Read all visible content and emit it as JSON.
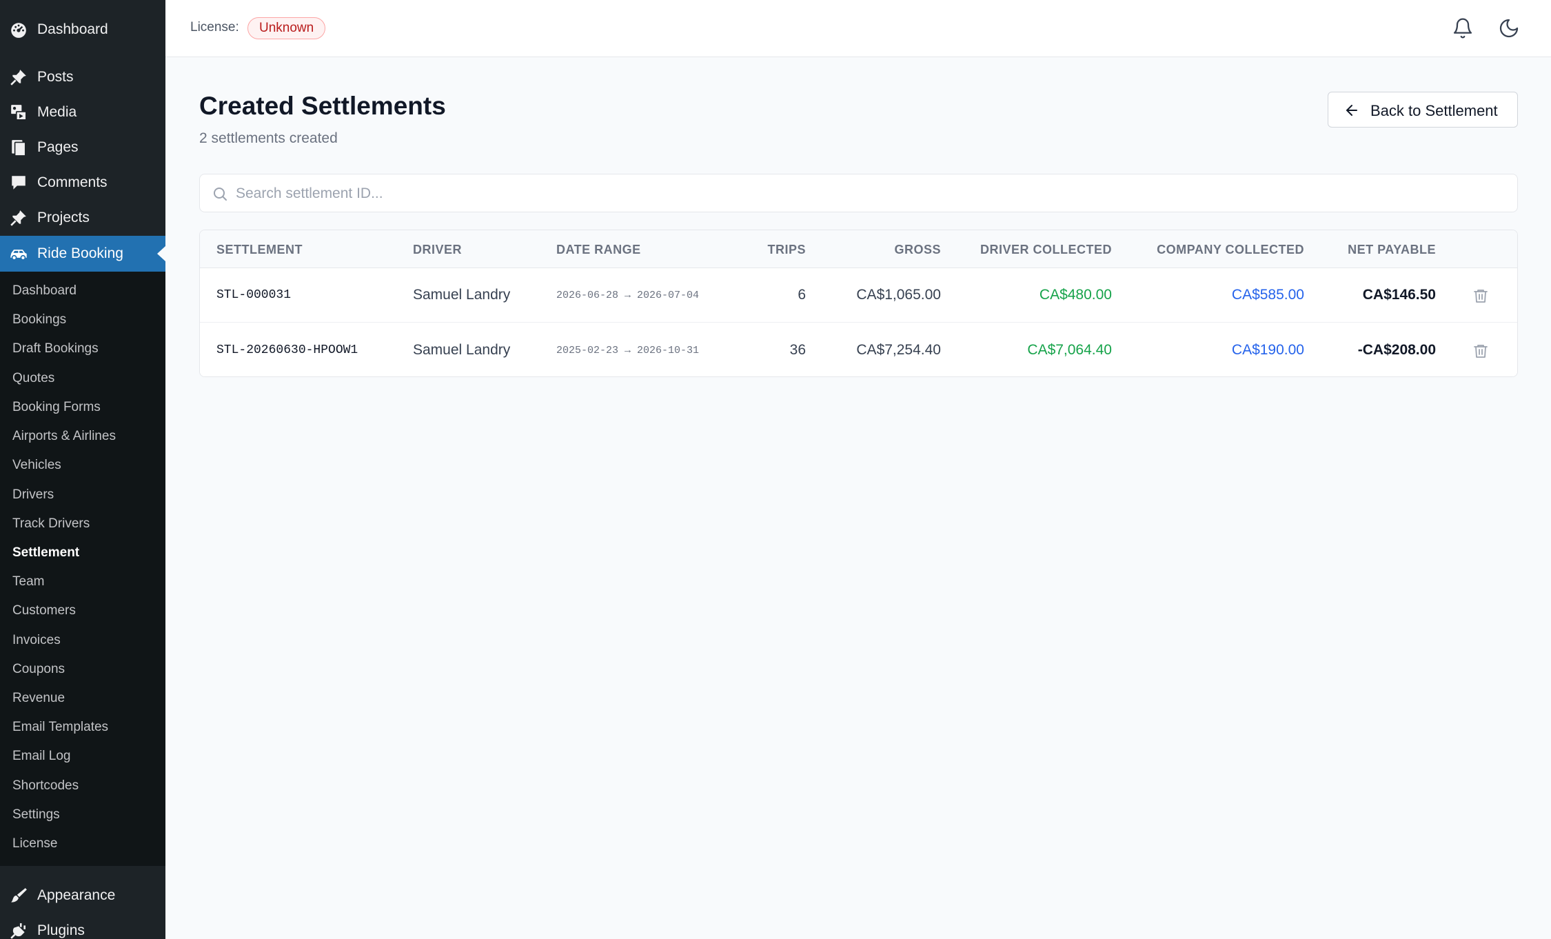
{
  "sidebar": {
    "top_items": [
      {
        "label": "Dashboard",
        "icon": "dashboard-icon"
      },
      {
        "label": "Posts",
        "icon": "pin-icon"
      },
      {
        "label": "Media",
        "icon": "media-icon"
      },
      {
        "label": "Pages",
        "icon": "pages-icon"
      },
      {
        "label": "Comments",
        "icon": "comment-icon"
      },
      {
        "label": "Projects",
        "icon": "pin-icon"
      },
      {
        "label": "Ride Booking",
        "icon": "car-icon"
      }
    ],
    "submenu": [
      "Dashboard",
      "Bookings",
      "Draft Bookings",
      "Quotes",
      "Booking Forms",
      "Airports & Airlines",
      "Vehicles",
      "Drivers",
      "Track Drivers",
      "Settlement",
      "Team",
      "Customers",
      "Invoices",
      "Coupons",
      "Revenue",
      "Email Templates",
      "Email Log",
      "Shortcodes",
      "Settings",
      "License"
    ],
    "current_submenu": "Settlement",
    "bottom_items": [
      {
        "label": "Appearance",
        "icon": "brush-icon"
      },
      {
        "label": "Plugins",
        "icon": "plugin-icon"
      }
    ]
  },
  "topbar": {
    "license_label": "License:",
    "license_status": "Unknown"
  },
  "header": {
    "title": "Created Settlements",
    "subtitle": "2 settlements created",
    "back_button": "Back to Settlement"
  },
  "search": {
    "placeholder": "Search settlement ID..."
  },
  "table": {
    "columns": [
      "SETTLEMENT",
      "DRIVER",
      "DATE RANGE",
      "TRIPS",
      "GROSS",
      "DRIVER COLLECTED",
      "COMPANY COLLECTED",
      "NET PAYABLE"
    ],
    "rows": [
      {
        "id": "STL-000031",
        "driver": "Samuel Landry",
        "date_range": "2026-06-28 → 2026-07-04",
        "trips": "6",
        "gross": "CA$1,065.00",
        "driver_collected": "CA$480.00",
        "company_collected": "CA$585.00",
        "net_payable": "CA$146.50"
      },
      {
        "id": "STL-20260630-HPOOW1",
        "driver": "Samuel Landry",
        "date_range": "2025-02-23 → 2026-10-31",
        "trips": "36",
        "gross": "CA$7,254.40",
        "driver_collected": "CA$7,064.40",
        "company_collected": "CA$190.00",
        "net_payable": "-CA$208.00"
      }
    ]
  },
  "colors": {
    "sidebar_bg": "#1d2327",
    "active_bg": "#2271b1",
    "driver_collected": "#16a34a",
    "company_collected": "#2563eb"
  }
}
